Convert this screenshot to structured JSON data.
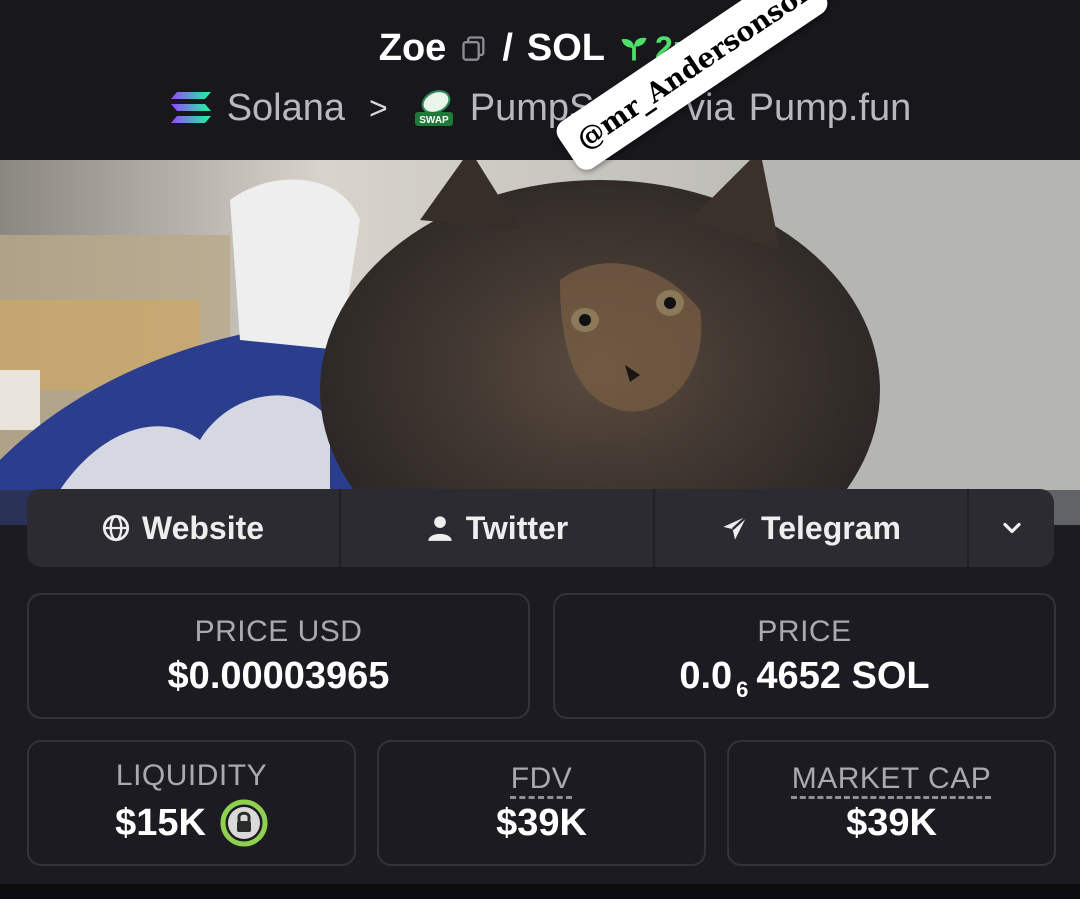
{
  "header": {
    "token_name": "Zoe",
    "separator": "/",
    "quote": "SOL",
    "age": "2m",
    "chain": "Solana",
    "dex": "PumpSwap",
    "via": "via",
    "launchpad": "Pump.fun"
  },
  "watermark": "@mr_Andersonsol",
  "links": {
    "website": "Website",
    "twitter": "Twitter",
    "telegram": "Telegram"
  },
  "stats": {
    "price_usd_label": "PRICE USD",
    "price_usd_value": "$0.00003965",
    "price_label": "PRICE",
    "price_prefix": "0.0",
    "price_zeros": "6",
    "price_rest": "4652 SOL",
    "liquidity_label": "LIQUIDITY",
    "liquidity_value": "$15K",
    "fdv_label": "FDV",
    "fdv_value": "$39K",
    "mcap_label": "MARKET CAP",
    "mcap_value": "$39K"
  },
  "colors": {
    "age_green": "#4ce06a",
    "lock_green": "#8fd14f",
    "background": "#1b1b21"
  }
}
